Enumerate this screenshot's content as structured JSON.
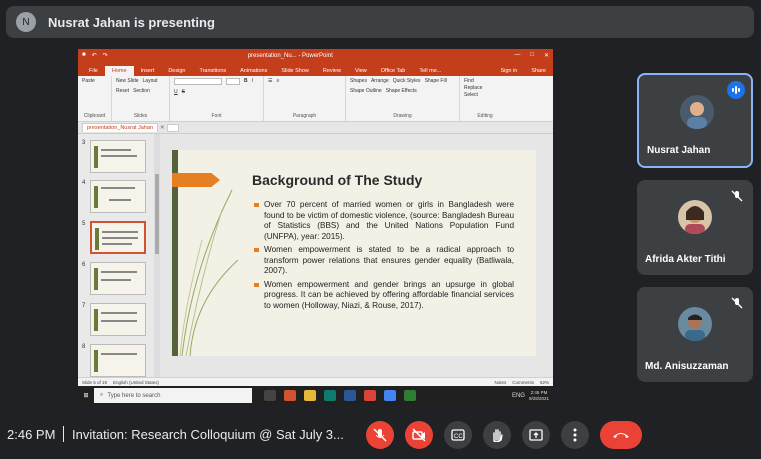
{
  "top_bar": {
    "presenter_text": "Nusrat Jahan is presenting",
    "avatar_initial": "N"
  },
  "powerpoint": {
    "document_title": "presentation_Nu... - PowerPoint",
    "menu_tabs": [
      "File",
      "Home",
      "Insert",
      "Design",
      "Transitions",
      "Animations",
      "Slide Show",
      "Review",
      "View",
      "Office Tab",
      "Tell me..."
    ],
    "active_tab": "Home",
    "menu_right": [
      "Sign in",
      "Share"
    ],
    "ribbon_groups": [
      {
        "label": "Clipboard",
        "items": [
          "Paste"
        ]
      },
      {
        "label": "Slides",
        "items": [
          "New Slide",
          "Layout",
          "Reset",
          "Section"
        ]
      },
      {
        "label": "Font",
        "items": [
          "B",
          "I",
          "U",
          "S"
        ]
      },
      {
        "label": "Paragraph",
        "items": []
      },
      {
        "label": "Drawing",
        "items": [
          "Shapes",
          "Arrange",
          "Quick Styles",
          "Shape Fill",
          "Shape Outline",
          "Shape Effects"
        ]
      },
      {
        "label": "Editing",
        "items": [
          "Find",
          "Replace",
          "Select"
        ]
      }
    ],
    "doc_tab": "presentation_Nusrat Jahan",
    "thumbnail_numbers": [
      "3",
      "4",
      "5",
      "6",
      "7",
      "8"
    ],
    "slide": {
      "title": "Background of The Study",
      "bullets": [
        "Over 70 percent of married women or girls in Bangladesh were found to be victim of domestic violence, (source: Bangladesh Bureau of Statistics (BBS) and the United Nations Population Fund (UNFPA), year: 2015).",
        "Women empowerment is stated to be a radical approach to transform power relations that ensures gender equality (Batliwala, 2007).",
        "Women empowerment and gender brings an upsurge in global progress. It can be achieved by offering affordable financial services to women (Holloway, Niazi, & Rouse, 2017)."
      ]
    },
    "status": {
      "slide_info": "Slide 5 of 19",
      "language": "English (United States)",
      "notes": "Notes",
      "comments": "Comments",
      "zoom": "62%"
    },
    "taskbar": {
      "search_placeholder": "Type here to search",
      "time": "2:45 PM",
      "date": "9/28/2021",
      "lang": "ENG"
    }
  },
  "participants": [
    {
      "name": "Nusrat Jahan",
      "speaking": true,
      "muted": false,
      "face_color": "#5b7fa6"
    },
    {
      "name": "Afrida Akter Tithi",
      "speaking": false,
      "muted": true,
      "face_color": "#c8956a"
    },
    {
      "name": "Md. Anisuzzaman",
      "speaking": false,
      "muted": true,
      "face_color": "#3a6a8a"
    }
  ],
  "bottom_bar": {
    "time": "2:46 PM",
    "meeting_title": "Invitation: Research Colloquium @ Sat July 3...",
    "controls": [
      "microphone-off",
      "camera-off",
      "captions",
      "raise-hand",
      "present",
      "more-options",
      "leave-call"
    ]
  },
  "colors": {
    "accent_red": "#ea4335",
    "ppt_orange": "#c43e1c",
    "active_blue": "#8ab4f8",
    "meet_bg": "#202124"
  }
}
